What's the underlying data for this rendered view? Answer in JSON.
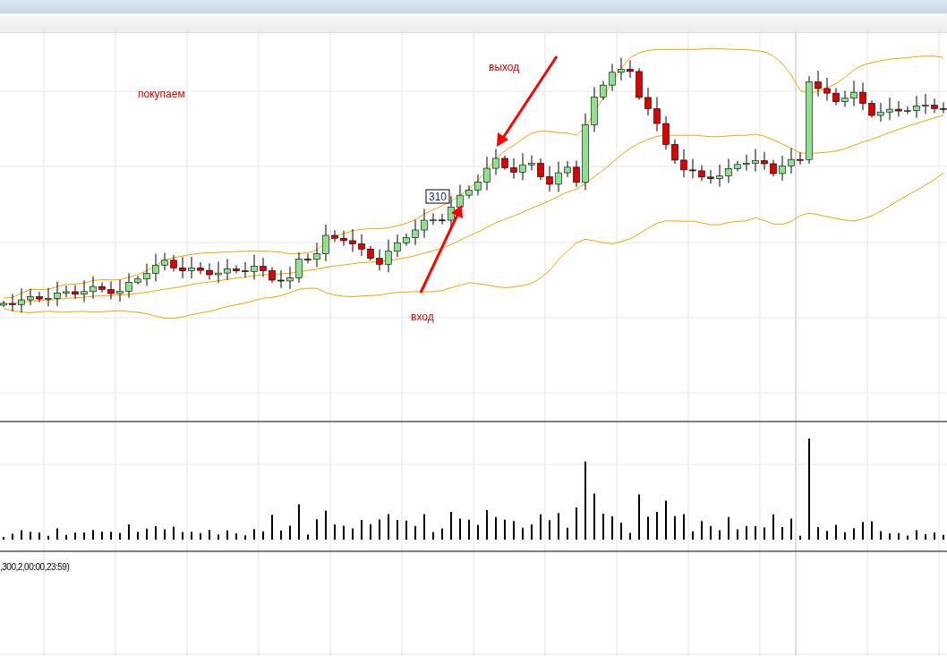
{
  "chart": {
    "buy_note": "покупаем",
    "exit_label": "выход",
    "entry_label": "вход",
    "price_tag": "310"
  },
  "indicator_pane": {
    "caption": ",300,2,00:00,23:59)"
  }
}
